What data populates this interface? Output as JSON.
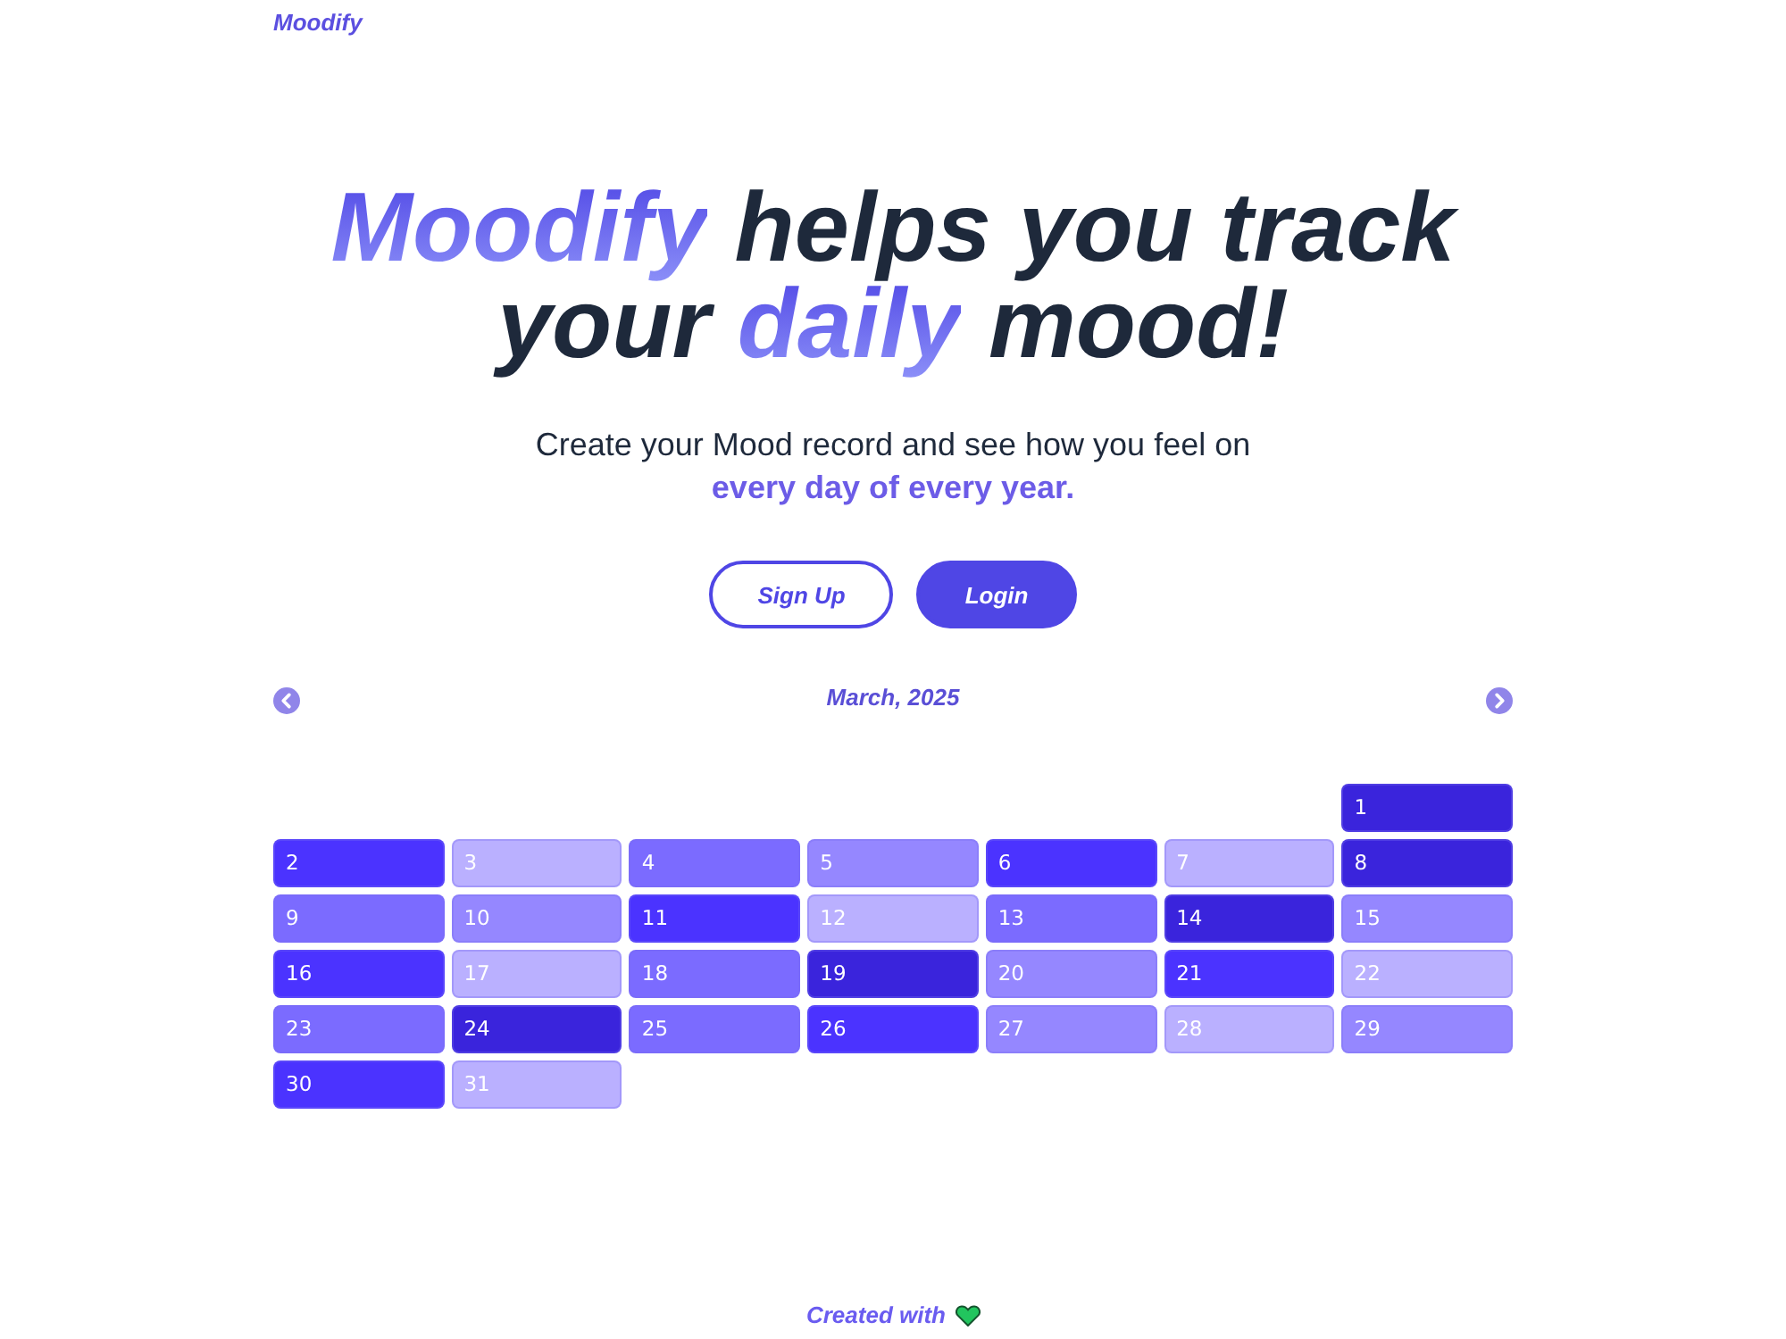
{
  "header": {
    "logo": "Moodify"
  },
  "hero": {
    "heading": "**Moodify** helps you track your **daily** mood!",
    "subtitle": "Create your Mood record and see how you feel on **every day of every year.**"
  },
  "buttons": [
    {
      "label": "Sign Up",
      "kind": "outline"
    },
    {
      "label": "Login",
      "kind": "filled"
    }
  ],
  "calendar": {
    "title": "March, 2025",
    "weeks": [
      [
        {
          "day": "1",
          "color": "#3a24dc"
        }
      ],
      [
        {
          "day": "2",
          "color": "#4b33ff"
        },
        {
          "day": "3",
          "color": "#bab0ff"
        },
        {
          "day": "4",
          "color": "#7b6bff"
        },
        {
          "day": "5",
          "color": "#9587ff"
        },
        {
          "day": "6",
          "color": "#4b33ff"
        },
        {
          "day": "7",
          "color": "#bab0ff"
        },
        {
          "day": "8",
          "color": "#3a24dc"
        }
      ],
      [
        {
          "day": "9",
          "color": "#7b6bff"
        },
        {
          "day": "10",
          "color": "#9587ff"
        },
        {
          "day": "11",
          "color": "#4b33ff"
        },
        {
          "day": "12",
          "color": "#bab0ff"
        },
        {
          "day": "13",
          "color": "#7b6bff"
        },
        {
          "day": "14",
          "color": "#3a24dc"
        },
        {
          "day": "15",
          "color": "#9587ff"
        }
      ],
      [
        {
          "day": "16",
          "color": "#4b33ff"
        },
        {
          "day": "17",
          "color": "#bab0ff"
        },
        {
          "day": "18",
          "color": "#7b6bff"
        },
        {
          "day": "19",
          "color": "#3a24dc"
        },
        {
          "day": "20",
          "color": "#9587ff"
        },
        {
          "day": "21",
          "color": "#4b33ff"
        },
        {
          "day": "22",
          "color": "#bab0ff"
        }
      ],
      [
        {
          "day": "23",
          "color": "#7b6bff"
        },
        {
          "day": "24",
          "color": "#3a24dc"
        },
        {
          "day": "25",
          "color": "#7b6bff"
        },
        {
          "day": "26",
          "color": "#4b33ff"
        },
        {
          "day": "27",
          "color": "#9587ff"
        },
        {
          "day": "28",
          "color": "#bab0ff"
        },
        {
          "day": "29",
          "color": "#9587ff"
        }
      ],
      [
        {
          "day": "30",
          "color": "#4b33ff"
        },
        {
          "day": "31",
          "color": "#bab0ff"
        }
      ]
    ]
  },
  "footer": {
    "text": "Created with"
  }
}
